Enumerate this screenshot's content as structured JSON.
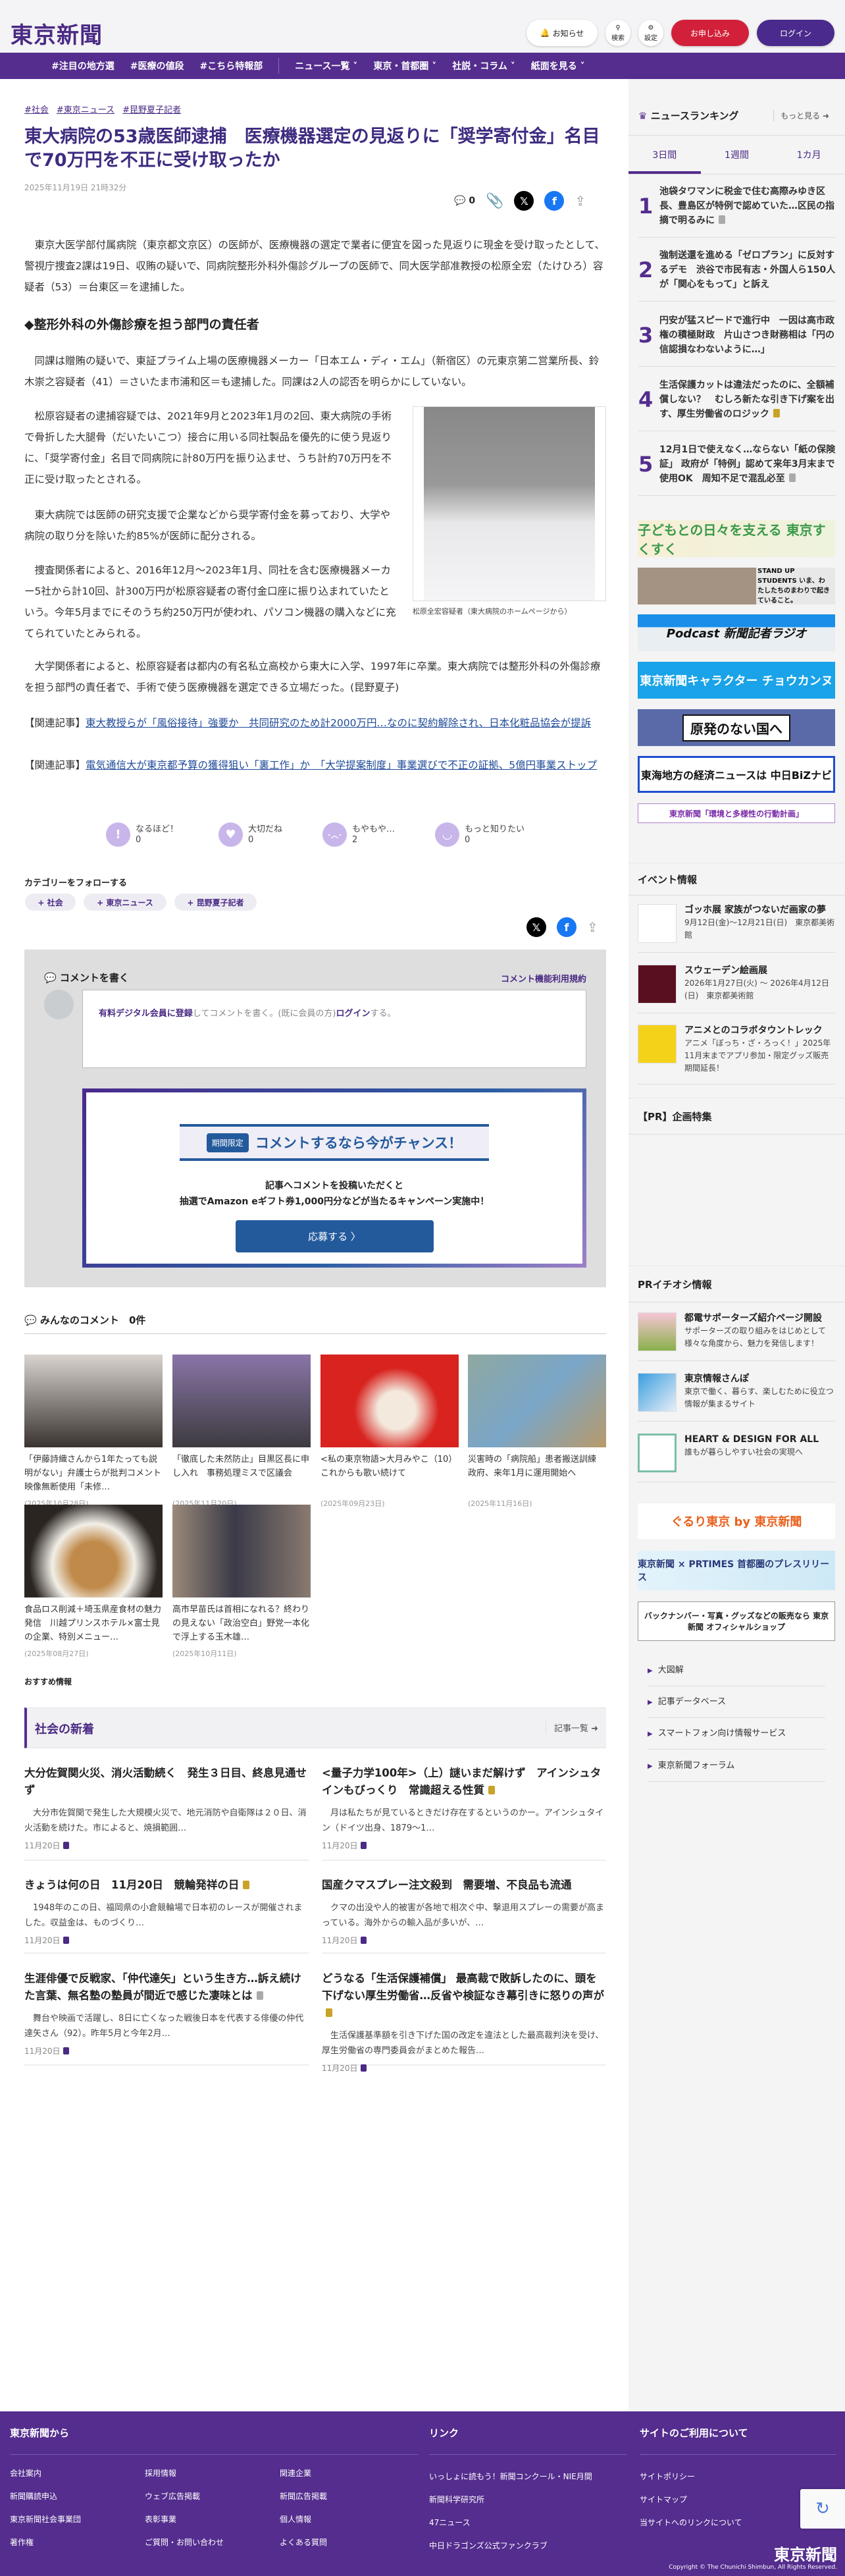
{
  "header": {
    "logo": "東京新聞",
    "notice": "お知らせ",
    "search": "検索",
    "settings": "設定",
    "subscribe": "お申し込み",
    "login": "ログイン"
  },
  "nav": [
    "#注目の地方選",
    "#医療の値段",
    "#こちら特報部",
    "ニュース一覧",
    "東京・首都圏",
    "社説・コラム",
    "紙面を見る"
  ],
  "article": {
    "tags": [
      "#社会",
      "#東京ニュース",
      "#昆野夏子記者"
    ],
    "title": "東大病院の53歳医師逮捕　医療機器選定の見返りに「奨学寄付金」名目で70万円を不正に受け取ったか",
    "date": "2025年11月19日 21時32分",
    "comment_count": "0",
    "paragraphs": [
      "東京大医学部付属病院（東京都文京区）の医師が、医療機器の選定で業者に便宜を図った見返りに現金を受け取ったとして、警視庁捜査2課は19日、収賄の疑いで、同病院整形外科外傷診グループの医師で、同大医学部准教授の松原全宏（たけひろ）容疑者（53）＝台東区＝を逮捕した。",
      "同課は贈賄の疑いで、東証プライム上場の医療機器メーカー「日本エム・ディ・エム」（新宿区）の元東京第二営業所長、鈴木崇之容疑者（41）＝さいたま市浦和区＝も逮捕した。同課は2人の認否を明らかにしていない。",
      "松原容疑者の逮捕容疑では、2021年9月と2023年1月の2回、東大病院の手術で骨折した大腿骨（だいたいこつ）接合に用いる同社製品を優先的に使う見返りに、「奨学寄付金」名目で同病院に計80万円を振り込ませ、うち計約70万円を不正に受け取ったとされる。",
      "東大病院では医師の研究支援で企業などから奨学寄付金を募っており、大学や病院の取り分を除いた約85%が医師に配分される。",
      "捜査関係者によると、2016年12月～2023年1月、同社を含む医療機器メーカー5社から計10回、計300万円が松原容疑者の寄付金口座に振り込まれていたという。今年5月までにそのうち約250万円が使われ、パソコン機器の購入などに充てられていたとみられる。",
      "大学関係者によると、松原容疑者は都内の有名私立高校から東大に入学、1997年に卒業。東大病院では整形外科の外傷診療を担う部門の責任者で、手術で使う医療機器を選定できる立場だった。(昆野夏子)"
    ],
    "subheading": "◆整形外科の外傷診療を担う部門の責任者",
    "photo_caption": "松原全宏容疑者（東大病院のホームページから）",
    "related_label": "【関連記事】",
    "related": [
      "東大教授らが「風俗接待」強要か　共同研究のため計2000万円…なのに契約解除され、日本化粧品協会が提訴",
      "電気通信大が東京都予算の獲得狙い「裏工作」か　「大学提案制度」事業選びで不正の証拠、5億円事業ストップ"
    ]
  },
  "reactions": [
    {
      "label": "なるほど！",
      "count": "0",
      "icon": "!"
    },
    {
      "label": "大切だね",
      "count": "0",
      "icon": "♥"
    },
    {
      "label": "もやもや…",
      "count": "2",
      "icon": "･︿･"
    },
    {
      "label": "もっと知りたい",
      "count": "0",
      "icon": "◡"
    }
  ],
  "follow": {
    "label": "カテゴリーをフォローする",
    "chips": [
      "+ 社会",
      "+ 東京ニュース",
      "+ 昆野夏子記者"
    ]
  },
  "comment": {
    "heading": "コメントを書く",
    "terms": "コメント機能利用規約",
    "register": "有料デジタル会員に登録",
    "mid": "してコメントを書く。(既に会員の方)",
    "login": "ログイン",
    "end": "する。",
    "campaign": {
      "badge": "期間限定",
      "headline": "コメントするなら今がチャンス！",
      "line1": "記事へコメントを投稿いただくと",
      "line2": "抽選でAmazon eギフト券1,000円分などが当たるキャンペーン実施中！",
      "button": "応募する 〉"
    }
  },
  "all_comments": {
    "label": "みんなのコメント",
    "count": "0件"
  },
  "cards": [
    {
      "caption": "「伊藤詩織さんから1年たっても説明がない」弁護士らが批判コメント　映像無断使用「未修…",
      "date": "(2025年10月28日)"
    },
    {
      "caption": "「徹底した未然防止」目黒区長に申し入れ　事務処理ミスで区議会",
      "date": "(2025年11月20日)"
    },
    {
      "caption": "<私の東京物語>大月みやこ（10）これからも歌い続けて",
      "date": "(2025年09月23日)"
    },
    {
      "caption": "災害時の「病院船」患者搬送訓練　政府、来年1月に運用開始へ",
      "date": "(2025年11月16日)"
    },
    {
      "caption": "食品ロス削減＋埼玉県産食材の魅力発信　川越プリンスホテル×富士見の企業、特別メニュー…",
      "date": "(2025年08月27日)"
    },
    {
      "caption": "高市早苗氏は首相になれる？終わりの見えない「政治空白」野党一本化で浮上する玉木雄…",
      "date": "(2025年10月11日)"
    }
  ],
  "recommend": "おすすめ情報",
  "society": {
    "title": "社会の新着",
    "more": "記事一覧 ➜",
    "items": [
      {
        "title": "大分佐賀関火災、消火活動続く　発生３日目、終息見通せず",
        "excerpt": "大分市佐賀関で発生した大規模火災で、地元消防や自衛隊は２０日、消火活動を続けた。市によると、焼損範囲…",
        "date": "11月20日",
        "lock": ""
      },
      {
        "title": "<量子力学100年>（上）謎いまだ解けず　アインシュタインもびっくり　常識超える性質",
        "excerpt": "月は私たちが見ているときだけ存在するというのかー。アインシュタイン（ドイツ出身、1879～1…",
        "date": "11月20日",
        "lock": "gold"
      },
      {
        "title": "きょうは何の日　11月20日　競輪発祥の日",
        "excerpt": "1948年のこの日、福岡県の小倉競輪場で日本初のレースが開催されました。収益金は、ものづくり…",
        "date": "11月20日",
        "lock": "gold"
      },
      {
        "title": "国産クマスプレー注文殺到　需要増、不良品も流通",
        "excerpt": "クマの出没や人的被害が各地で相次ぐ中、撃退用スプレーの需要が高まっている。海外からの輸入品が多いが、…",
        "date": "11月20日",
        "lock": ""
      },
      {
        "title": "生涯俳優で反戦家、「仲代達矢」という生き方…訴え続けた言葉、無名塾の塾員が間近で感じた凄味とは",
        "excerpt": "舞台や映画で活躍し、8日に亡くなった戦後日本を代表する俳優の仲代達矢さん（92）。昨年5月と今年2月…",
        "date": "11月20日",
        "lock": "gray"
      },
      {
        "title": "どうなる「生活保護補償」 最高裁で敗訴したのに、頭を下げない厚生労働省…反省や検証なき幕引きに怒りの声が",
        "excerpt": "生活保護基準額を引き下げた国の改定を違法とした最高裁判決を受け、厚生労働省の専門委員会がまとめた報告…",
        "date": "11月20日",
        "lock": "gold"
      }
    ]
  },
  "sidebar": {
    "ranking": {
      "title": "ニュースランキング",
      "more": "もっと見る ➜",
      "tabs": [
        "3日間",
        "1週間",
        "1カ月"
      ],
      "items": [
        {
          "rank": "1",
          "title": "池袋タワマンに税金で住む高際みゆき区長、豊島区が特例で認めていた…区民の指摘で明るみに",
          "lock": "gray"
        },
        {
          "rank": "2",
          "title": "強制送還を進める「ゼロプラン」に反対するデモ　渋谷で市民有志・外国人ら150人が「関心をもって」と訴え",
          "lock": ""
        },
        {
          "rank": "3",
          "title": "円安が猛スピードで進行中　一因は高市政権の積極財政　片山さつき財務相は「円の信認損なわないように…」",
          "lock": ""
        },
        {
          "rank": "4",
          "title": "生活保護カットは違法だったのに、全額補償しない？　むしろ新たな引き下げ案を出す、厚生労働省のロジック",
          "lock": "gold"
        },
        {
          "rank": "5",
          "title": "12月1日で使えなく…ならない「紙の保険証」 政府が「特例」認めて来年3月末まで使用OK　周知不足で混乱必至",
          "lock": "gray"
        }
      ]
    },
    "banners": [
      "子どもとの日々を支える 東京すくすく",
      "STAND UP STUDENTS いま、わたしたちのまわりで起きていること。",
      "Podcast 新聞記者ラジオ",
      "東京新聞キャラクター チョウカンヌ",
      "原発のない国へ",
      "東海地方の経済ニュースは 中日BiZナビ",
      "東京新聞「環境と多様性の行動計画」"
    ],
    "events": {
      "title": "イベント情報",
      "items": [
        {
          "title": "ゴッホ展 家族がつないだ画家の夢",
          "desc": "9月12日(金)～12月21日(日)　東京都美術館"
        },
        {
          "title": "スウェーデン絵画展",
          "desc": "2026年1月27日(火) ～ 2026年4月12日(日)　東京都美術館"
        },
        {
          "title": "アニメとのコラボタウントレック",
          "desc": "アニメ「ぼっち・ざ・ろっく！」2025年11月末までアプリ参加・限定グッズ販売期間延長！"
        }
      ]
    },
    "pr_feature": "【PR】企画特集",
    "pr_pick": {
      "title": "PRイチオシ情報",
      "items": [
        {
          "title": "都電サポーターズ紹介ページ開設",
          "desc": "サポーターズの取り組みをはじめとして様々な角度から、魅力を発信します！"
        },
        {
          "title": "東京情報さんぽ",
          "desc": "東京で働く、暮らす、楽しむために役立つ情報が集まるサイト"
        },
        {
          "title": "HEART & DESIGN FOR ALL",
          "desc": "誰もが暮らしやすい社会の実現へ"
        }
      ]
    },
    "banners2": [
      "ぐるり東京 by 東京新聞",
      "東京新聞 × PRTIMES 首都圏のプレスリリース",
      "バックナンバー・写真・グッズなどの販売なら 東京新聞 オフィシャルショップ"
    ],
    "links": [
      "大図解",
      "記事データベース",
      "スマートフォン向け情報サービス",
      "東京新聞フォーラム"
    ]
  },
  "footer": {
    "col1": {
      "title": "東京新聞から",
      "links": [
        "会社案内",
        "採用情報",
        "関連企業",
        "新聞購読申込",
        "ウェブ広告掲載",
        "新聞広告掲載",
        "東京新聞社会事業団",
        "表彰事業",
        "個人情報",
        "著作権",
        "ご質問・お問い合わせ",
        "よくある質問"
      ]
    },
    "col2": {
      "title": "リンク",
      "links": [
        "いっしょに読もう！新聞コンクール・NIE月間",
        "新聞科学研究所",
        "47ニュース",
        "中日ドラゴンズ公式ファンクラブ"
      ]
    },
    "col3": {
      "title": "サイトのご利用について",
      "links": [
        "サイトポリシー",
        "サイトマップ",
        "当サイトへのリンクについて"
      ]
    },
    "logo": "東京新聞",
    "copyright": "Copyright © The Chunichi Shimbun, All Rights Reserved."
  },
  "colors": {
    "brand_purple": "#542d8e",
    "title_purple": "#3f2b80",
    "subscribe_red": "#d3203a",
    "campaign_blue": "#235a9c"
  }
}
